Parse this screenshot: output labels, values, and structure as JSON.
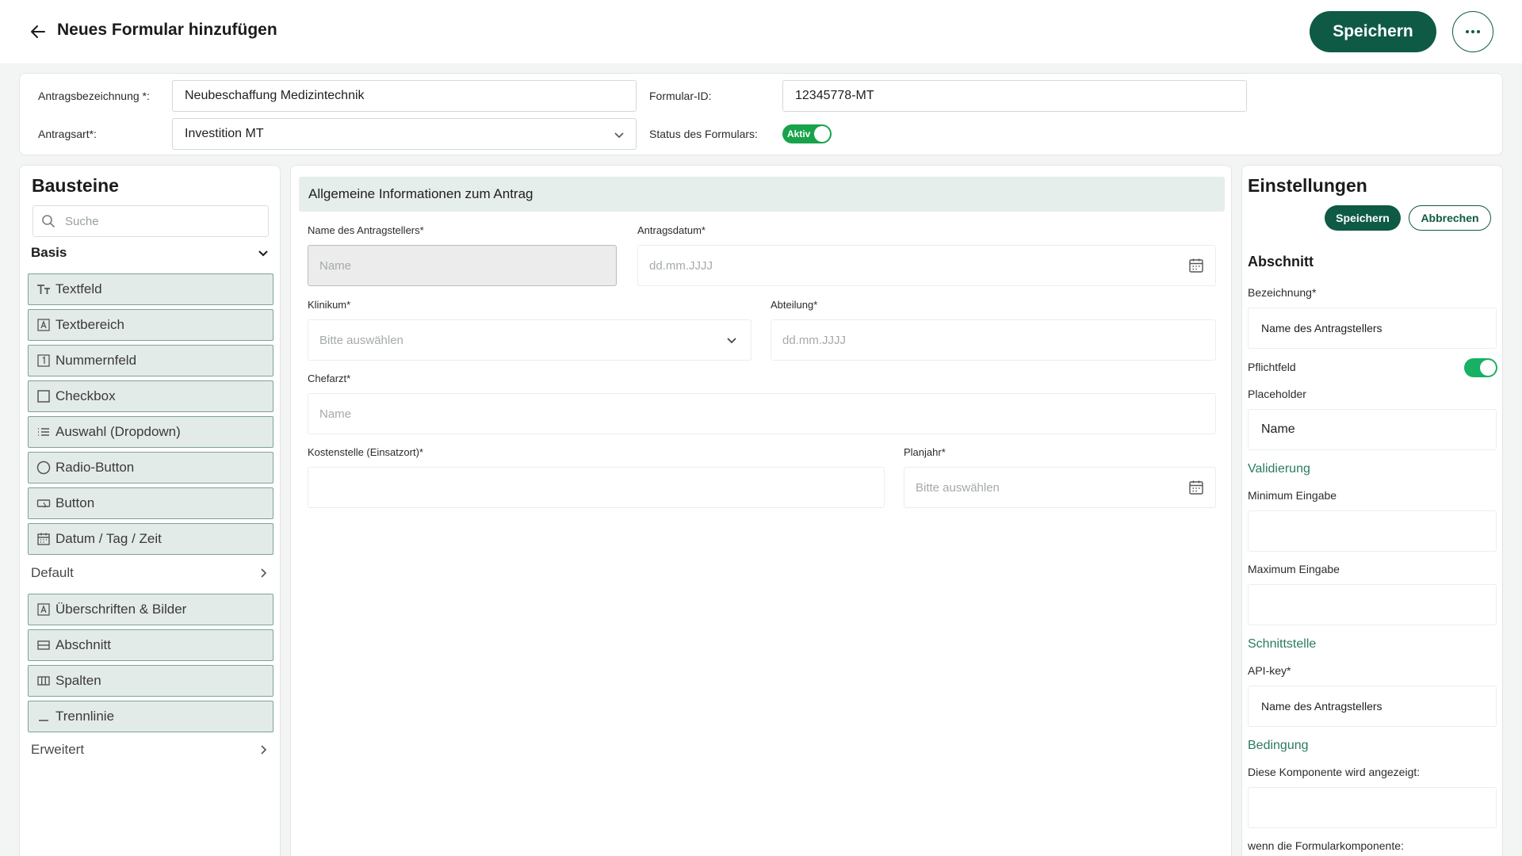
{
  "header": {
    "title": "Neues Formular hinzufügen",
    "save_label": "Speichern",
    "more_label": "···"
  },
  "meta": {
    "name_label": "Antragsbezeichnung *:",
    "name_value": "Neubeschaffung Medizintechnik",
    "type_label": "Antragsart*:",
    "type_value": "Investition MT",
    "id_label": "Formular-ID:",
    "id_value": "12345778-MT",
    "status_label": "Status des Formulars:",
    "status_value": "Aktiv"
  },
  "bausteine": {
    "title": "Bausteine",
    "search_placeholder": "Suche",
    "group_basis": "Basis",
    "basis_items": [
      {
        "label": "Textfeld",
        "icon": "text-type-icon"
      },
      {
        "label": "Textbereich",
        "icon": "text-area-icon"
      },
      {
        "label": "Nummernfeld",
        "icon": "number-field-icon"
      },
      {
        "label": "Checkbox",
        "icon": "checkbox-icon"
      },
      {
        "label": "Auswahl (Dropdown)",
        "icon": "list-icon"
      },
      {
        "label": "Radio-Button",
        "icon": "radio-icon"
      },
      {
        "label": "Button",
        "icon": "button-icon"
      },
      {
        "label": "Datum / Tag / Zeit",
        "icon": "calendar-icon"
      }
    ],
    "group_default": "Default",
    "default_items": [
      {
        "label": "Überschriften & Bilder",
        "icon": "heading-image-icon"
      },
      {
        "label": "Abschnitt",
        "icon": "section-icon"
      },
      {
        "label": "Spalten",
        "icon": "columns-icon"
      },
      {
        "label": "Trennlinie",
        "icon": "divider-icon"
      }
    ],
    "group_erweitert": "Erweitert"
  },
  "form": {
    "section_title": "Allgemeine Informationen zum Antrag",
    "fields": {
      "applicant_label": "Name des Antragstellers*",
      "applicant_placeholder": "Name",
      "date_label": "Antragsdatum*",
      "date_placeholder": "dd.mm.JJJJ",
      "clinic_label": "Klinikum*",
      "clinic_placeholder": "Bitte auswählen",
      "department_label": "Abteilung*",
      "department_placeholder": "dd.mm.JJJJ",
      "chief_label": "Chefarzt*",
      "chief_placeholder": "Name",
      "cost_label": "Kostenstelle (Einsatzort)*",
      "cost_placeholder": "",
      "year_label": "Planjahr*",
      "year_placeholder": "Bitte auswählen"
    }
  },
  "settings": {
    "title": "Einstellungen",
    "save_label": "Speichern",
    "cancel_label": "Abbrechen",
    "section_title": "Abschnitt",
    "bezeichnung_label": "Bezeichnung*",
    "bezeichnung_value": "Name des Antragstellers",
    "pflichtfeld_label": "Pflichtfeld",
    "pflichtfeld_on": true,
    "placeholder_label": "Placeholder",
    "placeholder_value": "Name",
    "validierung": "Validierung",
    "min_label": "Minimum Eingabe",
    "max_label": "Maximum Eingabe",
    "schnittstelle": "Schnittstelle",
    "apikey_label": "API-key*",
    "apikey_value": "Name des Antragstellers",
    "bedingung": "Bedingung",
    "condition_label": "Diese Komponente wird angezeigt:",
    "condition_when": "wenn die Formularkomponente:"
  },
  "colors": {
    "primary": "#0e5a45",
    "block_bg": "#e3ebe8",
    "block_border": "#7da393",
    "toggle_on": "#17a34a",
    "link": "#2a7a63"
  }
}
